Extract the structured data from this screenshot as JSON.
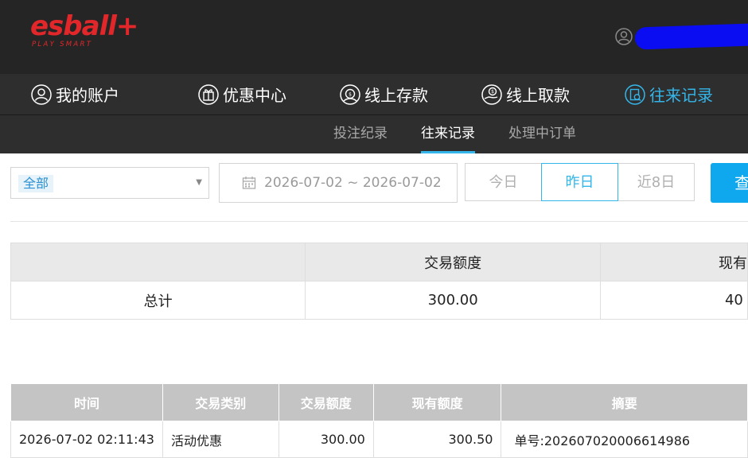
{
  "brand": {
    "name": "esball+",
    "tagline": "PLAY SMART",
    "accent": "#e2272b"
  },
  "nav": {
    "items": [
      {
        "label": "我的账户",
        "icon": "account-icon"
      },
      {
        "label": "优惠中心",
        "icon": "gift-icon",
        "badge": true
      },
      {
        "label": "线上存款",
        "icon": "deposit-icon"
      },
      {
        "label": "线上取款",
        "icon": "withdraw-icon"
      },
      {
        "label": "往来记录",
        "icon": "records-icon",
        "active": true
      }
    ]
  },
  "subnav": {
    "tabs": [
      {
        "label": "投注纪录"
      },
      {
        "label": "往来记录",
        "active": true
      },
      {
        "label": "处理中订单"
      }
    ]
  },
  "filters": {
    "type_selected": "全部",
    "date_range": "2026-07-02 ~ 2026-07-02",
    "quick": [
      "今日",
      "昨日",
      "近8日"
    ],
    "quick_active": "昨日",
    "search_label": "查"
  },
  "summary": {
    "headers": [
      "",
      "交易额度",
      "现有"
    ],
    "total_label": "总计",
    "total_amount": "300.00",
    "current_amount": "40"
  },
  "records": {
    "headers": [
      "时间",
      "交易类别",
      "交易额度",
      "现有额度",
      "摘要"
    ],
    "rows": [
      {
        "time": "2026-07-02 02:11:43",
        "type": "活动优惠",
        "amount": "300.00",
        "balance": "300.50",
        "summary": "单号:202607020006614986"
      }
    ]
  },
  "colors": {
    "active": "#34b6ea",
    "topbar": "#252525",
    "nav": "#2e2e2e"
  }
}
